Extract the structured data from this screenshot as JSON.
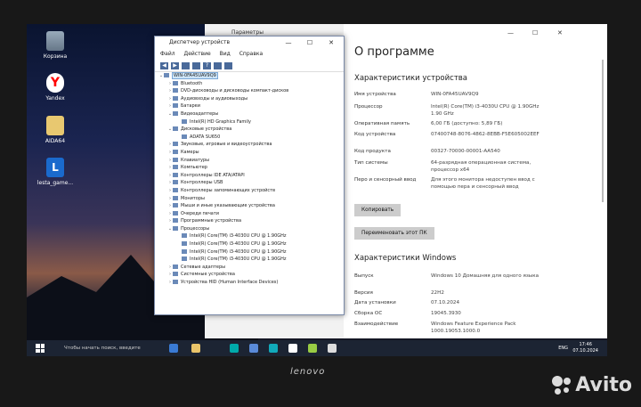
{
  "desktop": {
    "icons": [
      {
        "label": "Корзина"
      },
      {
        "label": "Yandex"
      },
      {
        "label": "AIDA64"
      },
      {
        "label": "lesta_game..."
      }
    ]
  },
  "device_manager": {
    "title": "Диспетчер устройств",
    "menu": [
      "Файл",
      "Действие",
      "Вид",
      "Справка"
    ],
    "tree": [
      {
        "label": "WIN-0FA45UAV9Q9",
        "level": 0,
        "exp": "⌄",
        "selected": true
      },
      {
        "label": "Bluetooth",
        "level": 1,
        "exp": "›"
      },
      {
        "label": "DVD-дисководы и дисководы компакт-дисков",
        "level": 1,
        "exp": "›"
      },
      {
        "label": "Аудиовходы и аудиовыходы",
        "level": 1,
        "exp": "›"
      },
      {
        "label": "Батареи",
        "level": 1,
        "exp": "›"
      },
      {
        "label": "Видеоадаптеры",
        "level": 1,
        "exp": "⌄"
      },
      {
        "label": "Intel(R) HD Graphics Family",
        "level": 2,
        "exp": ""
      },
      {
        "label": "Дисковые устройства",
        "level": 1,
        "exp": "⌄"
      },
      {
        "label": "ADATA SU650",
        "level": 2,
        "exp": ""
      },
      {
        "label": "Звуковые, игровые и видеоустройства",
        "level": 1,
        "exp": "›"
      },
      {
        "label": "Камеры",
        "level": 1,
        "exp": "›"
      },
      {
        "label": "Клавиатуры",
        "level": 1,
        "exp": "›"
      },
      {
        "label": "Компьютер",
        "level": 1,
        "exp": "›"
      },
      {
        "label": "Контроллеры IDE ATA/ATAPI",
        "level": 1,
        "exp": "›"
      },
      {
        "label": "Контроллеры USB",
        "level": 1,
        "exp": "›"
      },
      {
        "label": "Контроллеры запоминающих устройств",
        "level": 1,
        "exp": "›"
      },
      {
        "label": "Мониторы",
        "level": 1,
        "exp": "›"
      },
      {
        "label": "Мыши и иные указывающие устройства",
        "level": 1,
        "exp": "›"
      },
      {
        "label": "Очереди печати",
        "level": 1,
        "exp": "›"
      },
      {
        "label": "Программные устройства",
        "level": 1,
        "exp": "›"
      },
      {
        "label": "Процессоры",
        "level": 1,
        "exp": "⌄"
      },
      {
        "label": "Intel(R) Core(TM) i3-4030U CPU @ 1.90GHz",
        "level": 2,
        "exp": ""
      },
      {
        "label": "Intel(R) Core(TM) i3-4030U CPU @ 1.90GHz",
        "level": 2,
        "exp": ""
      },
      {
        "label": "Intel(R) Core(TM) i3-4030U CPU @ 1.90GHz",
        "level": 2,
        "exp": ""
      },
      {
        "label": "Intel(R) Core(TM) i3-4030U CPU @ 1.90GHz",
        "level": 2,
        "exp": ""
      },
      {
        "label": "Сетевые адаптеры",
        "level": 1,
        "exp": "›"
      },
      {
        "label": "Системные устройства",
        "level": 1,
        "exp": "›"
      },
      {
        "label": "Устройства HID (Human Interface Devices)",
        "level": 1,
        "exp": "›"
      }
    ]
  },
  "settings": {
    "nav_title": "Параметры",
    "heading": "О программе",
    "device_section": "Характеристики устройства",
    "device_specs": [
      {
        "key": "Имя устройства",
        "value": "WIN-0FA45UAV9Q9"
      },
      {
        "key": "Процессор",
        "value": "Intel(R) Core(TM) i3-4030U CPU @ 1.90GHz   1.90 GHz"
      },
      {
        "key": "Оперативная память",
        "value": "6,00 ГБ (доступно: 5,89 ГБ)"
      },
      {
        "key": "Код устройства",
        "value": "07400748-8076-4862-8EBB-F5E605002EEF"
      },
      {
        "key": "Код продукта",
        "value": "00327-70000-00001-AA540"
      },
      {
        "key": "Тип системы",
        "value": "64-разрядная операционная система, процессор x64"
      },
      {
        "key": "Перо и сенсорный ввод",
        "value": "Для этого монитора недоступен ввод с помощью пера и сенсорный ввод"
      }
    ],
    "copy_button": "Копировать",
    "rename_button": "Переименовать этот ПК",
    "windows_section": "Характеристики Windows",
    "windows_specs": [
      {
        "key": "Выпуск",
        "value": "Windows 10 Домашняя для одного языка"
      },
      {
        "key": "Версия",
        "value": "22H2"
      },
      {
        "key": "Дата установки",
        "value": "07.10.2024"
      },
      {
        "key": "Сборка ОС",
        "value": "19045.3930"
      },
      {
        "key": "Взаимодействие",
        "value": "Windows Feature Experience Pack 1000.19053.1000.0"
      }
    ],
    "window_controls": [
      "—",
      "☐",
      "✕"
    ]
  },
  "taskbar": {
    "search_placeholder": "Чтобы начать поиск, введите",
    "lang": "ENG",
    "time": "17:46",
    "date": "07.10.2024"
  },
  "brand": "lenovo",
  "watermark": "Avito"
}
